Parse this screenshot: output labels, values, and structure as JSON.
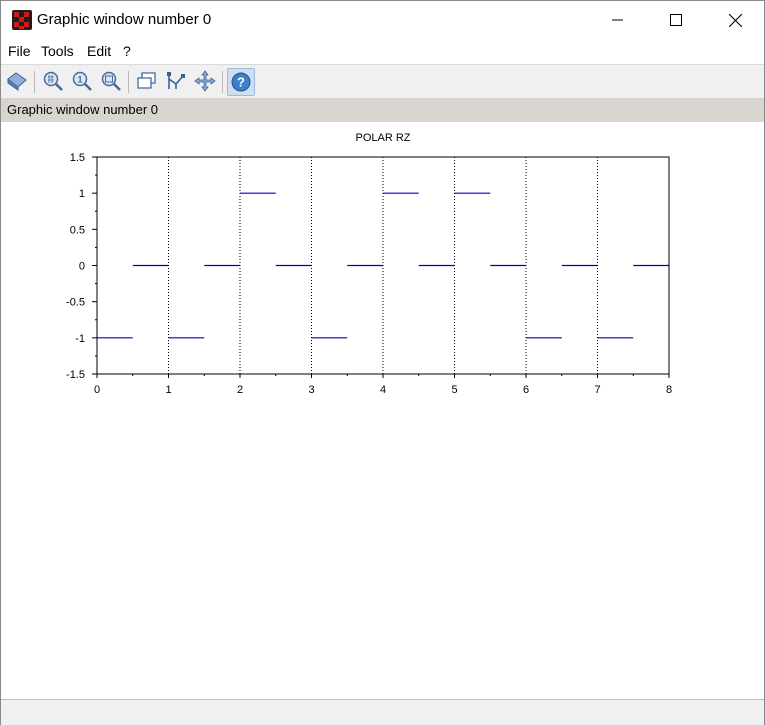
{
  "window": {
    "title": "Graphic window number 0"
  },
  "menu": {
    "items": [
      "File",
      "Tools",
      "Edit",
      "?"
    ]
  },
  "toolbar": {
    "buttons": [
      "figure-to-front-icon",
      "zoom-icon",
      "zoom-original-icon",
      "zoom-region-icon",
      "datatip-icon",
      "datatip-manager-icon",
      "pan-icon",
      "help-icon"
    ]
  },
  "infobar": {
    "label": "Graphic window number 0"
  },
  "chart_data": {
    "type": "line",
    "title": "POLAR RZ",
    "xlabel": "",
    "ylabel": "",
    "xlim": [
      0,
      8
    ],
    "ylim": [
      -1.5,
      1.5
    ],
    "x_ticks": [
      "0",
      "1",
      "2",
      "3",
      "4",
      "5",
      "6",
      "7",
      "8"
    ],
    "y_ticks": [
      "1.5",
      "1",
      "0.5",
      "0",
      "-0.5",
      "-1",
      "-1.5"
    ],
    "grid": "vertical dotted at integer x",
    "color": "#0000c8",
    "segments": [
      {
        "x0": 0,
        "x1": 0.5,
        "y": -1
      },
      {
        "x0": 0.5,
        "x1": 1,
        "y": 0
      },
      {
        "x0": 1,
        "x1": 1.5,
        "y": -1
      },
      {
        "x0": 1.5,
        "x1": 2,
        "y": 0
      },
      {
        "x0": 2,
        "x1": 2.5,
        "y": 1
      },
      {
        "x0": 2.5,
        "x1": 3,
        "y": 0
      },
      {
        "x0": 3,
        "x1": 3.5,
        "y": -1
      },
      {
        "x0": 3.5,
        "x1": 4,
        "y": 0
      },
      {
        "x0": 4,
        "x1": 4.5,
        "y": 1
      },
      {
        "x0": 4.5,
        "x1": 5,
        "y": 0
      },
      {
        "x0": 5,
        "x1": 5.5,
        "y": 1
      },
      {
        "x0": 5.5,
        "x1": 6,
        "y": 0
      },
      {
        "x0": 6,
        "x1": 6.5,
        "y": -1
      },
      {
        "x0": 6.5,
        "x1": 7,
        "y": 0
      },
      {
        "x0": 7,
        "x1": 7.5,
        "y": -1
      },
      {
        "x0": 7.5,
        "x1": 8,
        "y": 0
      }
    ]
  },
  "statusbar": {
    "text": ""
  }
}
